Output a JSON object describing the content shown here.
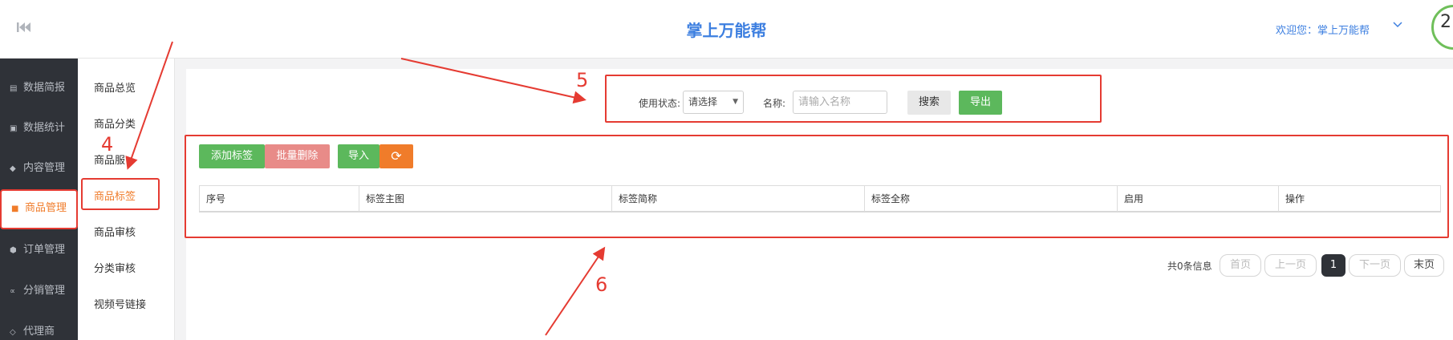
{
  "topbar": {
    "title": "掌上万能帮",
    "welcome": "欢迎您：掌上万能帮",
    "avatar_text": "2"
  },
  "sidebar": {
    "items": [
      {
        "icon": "bar-chart-icon",
        "label": "数据简报"
      },
      {
        "icon": "monitor-icon",
        "label": "数据统计"
      },
      {
        "icon": "tag-icon",
        "label": "内容管理"
      },
      {
        "icon": "bag-icon",
        "label": "商品管理"
      },
      {
        "icon": "cube-icon",
        "label": "订单管理"
      },
      {
        "icon": "share-icon",
        "label": "分销管理"
      },
      {
        "icon": "diamond-icon",
        "label": "代理商"
      }
    ],
    "active": "商品管理"
  },
  "submenu": {
    "items": [
      "商品总览",
      "商品分类",
      "商品服",
      "商品标签",
      "商品审核",
      "分类审核",
      "视频号链接"
    ],
    "active": "商品标签"
  },
  "search": {
    "status_label": "使用状态:",
    "status_value": "请选择",
    "name_label": "名称:",
    "name_placeholder": "请输入名称",
    "search_button": "搜索",
    "export_button": "导出"
  },
  "toolbar": {
    "add_label": "添加标签",
    "batch_delete_label": "批量删除",
    "import_label": "导入"
  },
  "table": {
    "columns": [
      "序号",
      "标签主图",
      "标签简称",
      "标签全称",
      "启用",
      "操作"
    ]
  },
  "pagination": {
    "info": "共0条信息",
    "first": "首页",
    "prev": "上一页",
    "current": "1",
    "next": "下一页",
    "last": "末页"
  },
  "annotations": {
    "n4": "4",
    "n5": "5",
    "n6": "6"
  },
  "colors": {
    "brand_blue": "#3d7fe0",
    "accent_orange": "#f07c2a",
    "annotation_red": "#e53b32",
    "success_green": "#5cb85c",
    "sidebar_dark": "#2f3238"
  }
}
